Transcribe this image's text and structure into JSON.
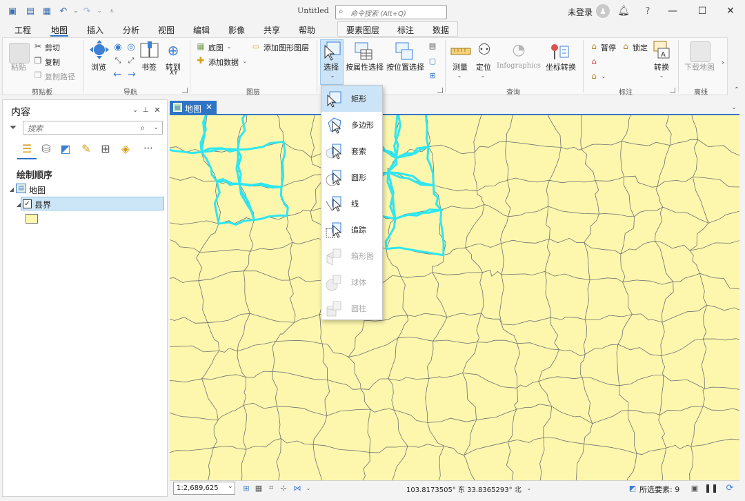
{
  "window": {
    "title": "Untitled",
    "search_placeholder": "命令搜索 (Alt+Q)",
    "login_label": "未登录",
    "help_label": "?"
  },
  "tabs": [
    "工程",
    "地图",
    "插入",
    "分析",
    "视图",
    "编辑",
    "影像",
    "共享",
    "帮助"
  ],
  "context_tabs": [
    "要素图层",
    "标注",
    "数据"
  ],
  "ribbon": {
    "clipboard": {
      "paste": "粘贴",
      "cut": "剪切",
      "copy": "复制",
      "copy_path": "复制路径",
      "label": "剪贴板"
    },
    "navigate": {
      "explore": "浏览",
      "bookmarks": "书签",
      "goto": "转到",
      "goto_sub": "XY",
      "label": "导航"
    },
    "layer": {
      "basemap": "底图",
      "add_data": "添加数据",
      "add_graphics": "添加图形图层",
      "label": "图层"
    },
    "selection": {
      "select": "选择",
      "by_attr": "按属性选择",
      "by_loc": "按位置选择"
    },
    "inquiry": {
      "measure": "测量",
      "locate": "定位",
      "infographics": "Infographics",
      "coord": "坐标转换",
      "label": "查询"
    },
    "labeling": {
      "pause": "暂停",
      "lock": "锁定",
      "convert": "转换",
      "label": "标注"
    },
    "offline": {
      "download": "下载地图",
      "label": "离线"
    }
  },
  "contents": {
    "title": "内容",
    "search_placeholder": "搜索",
    "draw_order": "绘制顺序",
    "map_name": "地图",
    "layer_name": "县界",
    "layer_checked": true,
    "colors": {
      "fill": "#fff8b0",
      "outline": "#6e6e6e"
    }
  },
  "map": {
    "tab_label": "地图",
    "selection_color": "#2fe6ef",
    "fill_color": "#fdf7ae"
  },
  "status": {
    "scale": "1:2,689,625",
    "coords": "103.8173505° 东 33.8365293° 北",
    "selected_features": "所选要素: 9"
  },
  "select_menu": [
    {
      "label": "矩形",
      "enabled": true,
      "highlighted": true
    },
    {
      "label": "多边形",
      "enabled": true
    },
    {
      "label": "套索",
      "enabled": true
    },
    {
      "label": "圆形",
      "enabled": true
    },
    {
      "label": "线",
      "enabled": true
    },
    {
      "label": "追踪",
      "enabled": true
    },
    {
      "label": "箱形图",
      "enabled": false
    },
    {
      "label": "球体",
      "enabled": false
    },
    {
      "label": "圆柱",
      "enabled": false
    }
  ]
}
